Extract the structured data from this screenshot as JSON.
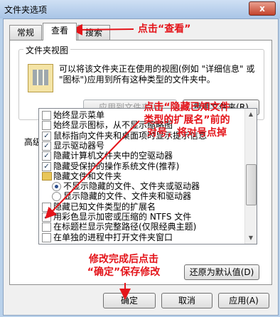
{
  "window": {
    "title": "文件夹选项",
    "close_label": "x"
  },
  "tabs": [
    {
      "label": "常规"
    },
    {
      "label": "查看"
    },
    {
      "label": "搜索"
    }
  ],
  "folder_view": {
    "title": "文件夹视图",
    "description": "可以将该文件夹正在使用的视图(例如 \"详细信息\" 或 \"图标\")应用到所有这种类型的文件夹中。",
    "apply_button": "应用到文件夹(L)",
    "reset_button": "重置文件夹(R)"
  },
  "advanced": {
    "label": "高级设置:",
    "items": [
      {
        "kind": "checkbox",
        "checked": false,
        "label": "始终显示菜单"
      },
      {
        "kind": "checkbox",
        "checked": false,
        "label": "始终显示图标，从不显示缩略图"
      },
      {
        "kind": "checkbox",
        "checked": true,
        "label": "鼠标指向文件夹和桌面项时显示提示信息"
      },
      {
        "kind": "checkbox",
        "checked": true,
        "label": "显示驱动器号"
      },
      {
        "kind": "checkbox",
        "checked": true,
        "label": "隐藏计算机文件夹中的空驱动器"
      },
      {
        "kind": "checkbox",
        "checked": true,
        "label": "隐藏受保护的操作系统文件(推荐)"
      },
      {
        "kind": "folder",
        "label": "隐藏文件和文件夹"
      },
      {
        "kind": "radio",
        "checked": true,
        "label": "不显示隐藏的文件、文件夹或驱动器"
      },
      {
        "kind": "radio",
        "checked": false,
        "label": "显示隐藏的文件、文件夹和驱动器"
      },
      {
        "kind": "checkbox",
        "checked": false,
        "label": "隐藏已知文件类型的扩展名"
      },
      {
        "kind": "checkbox",
        "checked": true,
        "label": "用彩色显示加密或压缩的 NTFS 文件"
      },
      {
        "kind": "checkbox",
        "checked": false,
        "label": "在标题栏显示完整路径(仅限经典主题)"
      },
      {
        "kind": "checkbox",
        "checked": false,
        "label": "在单独的进程中打开文件夹窗口"
      }
    ],
    "restore_button": "还原为默认值(D)"
  },
  "footer": {
    "ok": "确定",
    "cancel": "取消",
    "apply": "应用(A)"
  },
  "annotations": {
    "click_view": "点击“查看”",
    "uncheck_1": "点击“隐藏已知文件",
    "uncheck_2": "类型的扩展名”前的",
    "uncheck_3": "对号，将对号点掉",
    "confirm_1": "修改完成后点击",
    "confirm_2": "“确定”保存修改"
  },
  "colors": {
    "annotation": "#e4141a",
    "titlebar": "#b9d1ea",
    "dialog": "#f0f0f0"
  }
}
